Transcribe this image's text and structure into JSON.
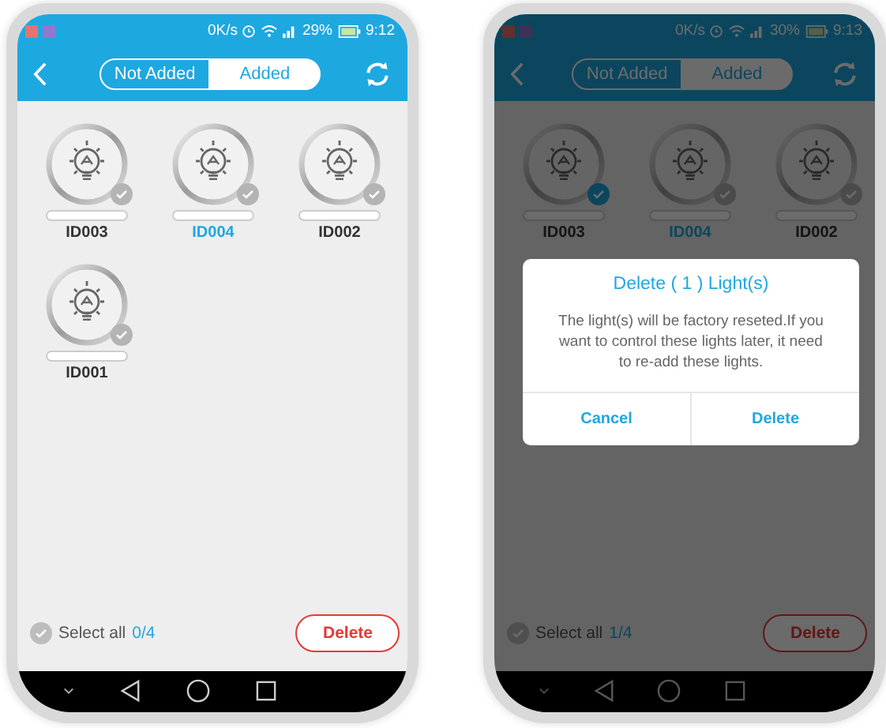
{
  "phones": [
    {
      "status": {
        "speed": "0K/s",
        "battery": "29%",
        "time": "9:12"
      },
      "tabs": [
        {
          "label": "Not Added",
          "selected": false
        },
        {
          "label": "Added",
          "selected": true
        }
      ],
      "lights": [
        {
          "kind": "tile",
          "label": "ID003",
          "checked": false,
          "active": false
        },
        {
          "kind": "tile",
          "label": "ID004",
          "checked": false,
          "active": true
        },
        {
          "kind": "tile",
          "label": "ID002",
          "checked": false,
          "active": false
        },
        {
          "kind": "tile",
          "label": "ID001",
          "checked": false,
          "active": false
        }
      ],
      "select_all": {
        "label": "Select all",
        "count": "0/4",
        "checked": false
      },
      "delete_button": "Delete"
    },
    {
      "status": {
        "speed": "0K/s",
        "battery": "30%",
        "time": "9:13"
      },
      "tabs": [
        {
          "label": "Not Added",
          "selected": false
        },
        {
          "label": "Added",
          "selected": true
        }
      ],
      "lights": [
        {
          "kind": "tile",
          "label": "ID003",
          "checked": true,
          "active": false
        },
        {
          "kind": "tile",
          "label": "ID004",
          "checked": false,
          "active": true
        },
        {
          "kind": "tile",
          "label": "ID002",
          "checked": false,
          "active": false
        },
        {
          "kind": "covered"
        }
      ],
      "select_all": {
        "label": "Select all",
        "count": "1/4",
        "checked": false
      },
      "delete_button": "Delete",
      "dialog": {
        "title": "Delete ( 1 ) Light(s)",
        "message": "The light(s) will be factory reseted.If you want to control these lights later, it need to re-add these lights.",
        "buttons": [
          "Cancel",
          "Delete"
        ]
      }
    }
  ]
}
